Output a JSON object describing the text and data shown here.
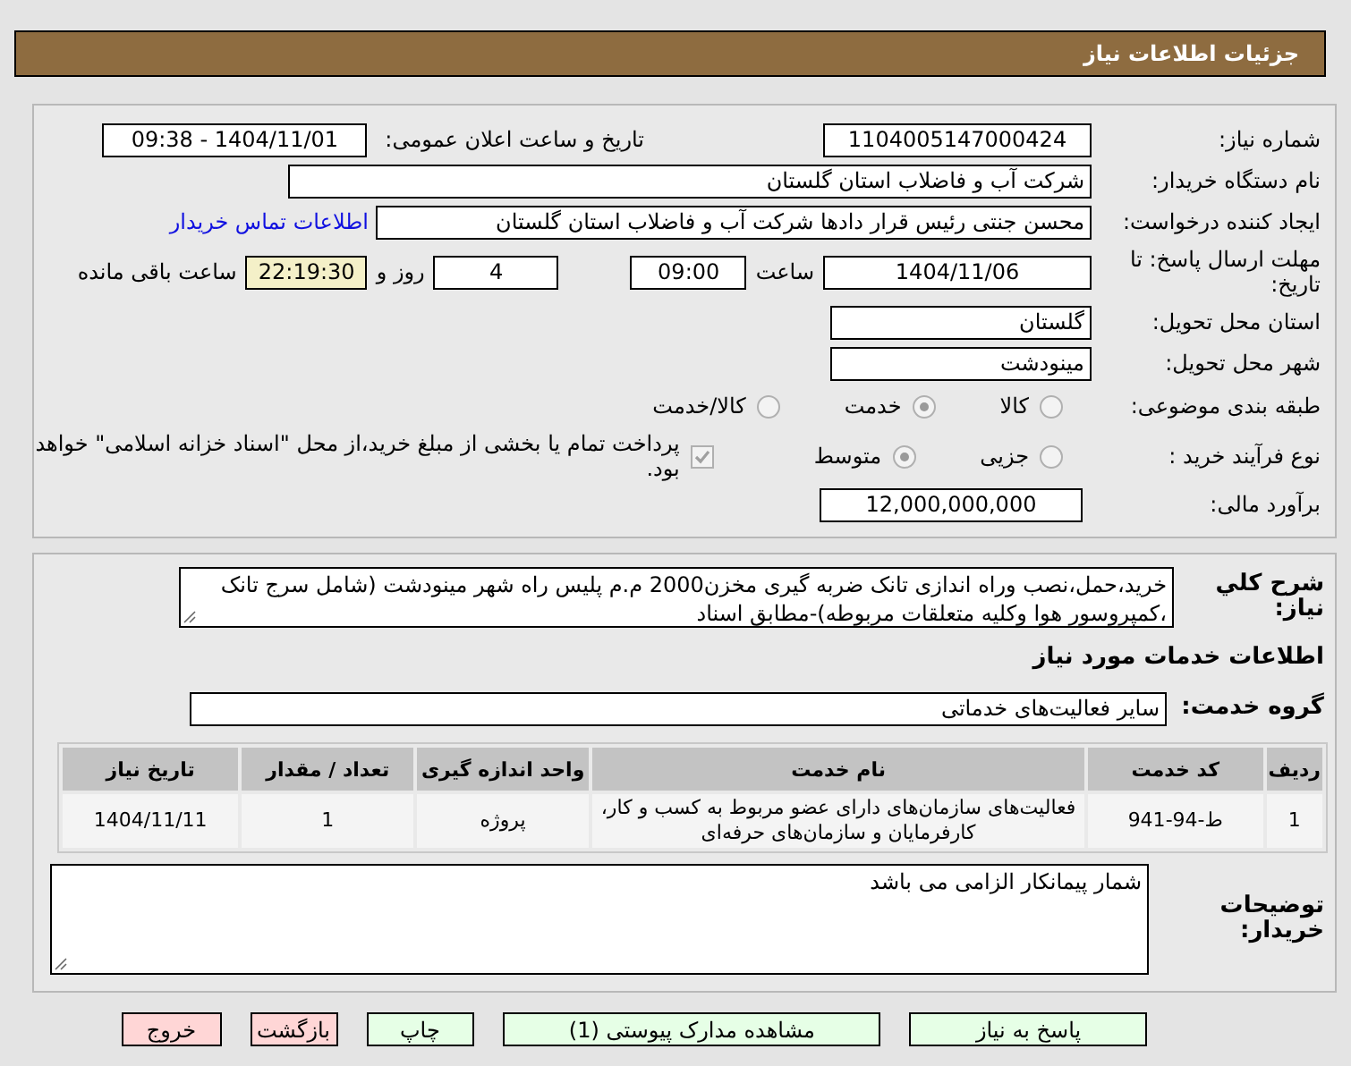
{
  "header": {
    "title": "جزئیات اطلاعات نیاز"
  },
  "need_number": {
    "label": "شماره نیاز:",
    "value": "1104005147000424"
  },
  "announce": {
    "label": "تاریخ و ساعت اعلان عمومی:",
    "value": "1404/11/01 - 09:38"
  },
  "buyer": {
    "label": "نام دستگاه خریدار:",
    "value": "شرکت آب و فاضلاب استان گلستان"
  },
  "requester": {
    "label": "ایجاد کننده درخواست:",
    "value": "محسن جنتی رئیس قرار دادها شرکت آب و فاضلاب استان گلستان",
    "link": "اطلاعات تماس خریدار"
  },
  "deadline": {
    "label": "مهلت ارسال پاسخ: تا تاریخ:",
    "date": "1404/11/06",
    "time_label": "ساعت",
    "time": "09:00",
    "days": "4",
    "days_label": "روز و",
    "remaining": "22:19:30",
    "remaining_label": "ساعت باقی مانده"
  },
  "province": {
    "label": "استان محل تحویل:",
    "value": "گلستان"
  },
  "city": {
    "label": "شهر محل تحویل:",
    "value": "مینودشت"
  },
  "category": {
    "label": "طبقه بندی موضوعی:",
    "options": [
      {
        "label": "کالا",
        "selected": false
      },
      {
        "label": "خدمت",
        "selected": true
      },
      {
        "label": "کالا/خدمت",
        "selected": false
      }
    ]
  },
  "process": {
    "label": "نوع فرآیند خرید :",
    "options": [
      {
        "label": "جزیی",
        "selected": false
      },
      {
        "label": "متوسط",
        "selected": true
      }
    ],
    "payment": {
      "checked": true,
      "text": "پرداخت تمام یا بخشی از مبلغ خرید،از محل \"اسناد خزانه اسلامی\" خواهد بود."
    }
  },
  "budget": {
    "label": "برآورد مالی:",
    "value": "12,000,000,000"
  },
  "description": {
    "label": "شرح کلي نياز:",
    "value": "خرید،حمل،نصب وراه اندازی تانک ضربه گیری مخزن2000 م.م پلیس راه شهر مینودشت (شامل سرج تانک ،کمپروسور هوا وکلیه متعلقات مربوطه)-مطابق اسناد"
  },
  "services_heading": "اطلاعات خدمات مورد نیاز",
  "service_group": {
    "label": "گروه خدمت:",
    "value": "سایر فعالیت‌های خدماتی"
  },
  "table": {
    "columns": [
      "ردیف",
      "کد خدمت",
      "نام خدمت",
      "واحد اندازه گیری",
      "تعداد / مقدار",
      "تاریخ نیاز"
    ],
    "rows": [
      [
        "1",
        "ط-94-941",
        "فعالیت‌های سازمان‌های دارای عضو مربوط به کسب و کار، کارفرمایان و سازمان‌های حرفه‌ای",
        "پروژه",
        "1",
        "1404/11/11"
      ]
    ]
  },
  "buyer_notes": {
    "label": "توضیحات خریدار:",
    "value": "شمار پیمانکار الزامی می باشد"
  },
  "buttons": [
    {
      "label": "پاسخ به نیاز",
      "kind": "action"
    },
    {
      "label": "مشاهده مدارک پیوستی (1)",
      "kind": "action"
    },
    {
      "label": "چاپ",
      "kind": "action"
    },
    {
      "label": "بازگشت",
      "kind": "exit"
    },
    {
      "label": "خروج",
      "kind": "exit"
    }
  ]
}
